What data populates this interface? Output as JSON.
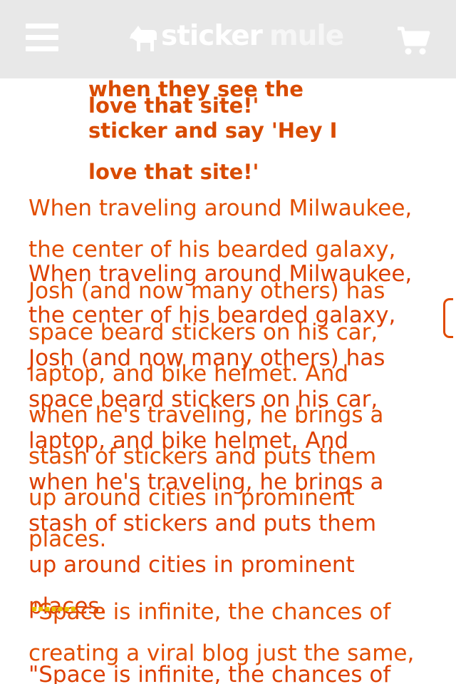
{
  "header": {
    "brand_part1": "sticker",
    "brand_part2": "mule",
    "menu_icon": "hamburger-menu-icon",
    "cart_icon": "shopping-cart-icon",
    "logo_icon": "mule-logo-icon"
  },
  "colors": {
    "header_bg": "#e8e8e8",
    "text_accent": "#e24a00"
  },
  "bold_lines_top": {
    "l1": "when they see the",
    "l2": "love that site!'"
  },
  "bold_lines": {
    "l1": "sticker and say 'Hey I",
    "l2": "love that site!'"
  },
  "para_a": {
    "l1": "When traveling around Milwaukee,",
    "l2": "the center of his bearded galaxy,",
    "l3": "Josh (and now many others) has",
    "l4": "space beard stickers on his car,",
    "l5": "laptop, and bike helmet. And",
    "l6": "when he's traveling, he brings a",
    "l7": "stash of stickers and puts them",
    "l8": "up around cities in prominent",
    "l9": "places."
  },
  "para_b": {
    "l1": "When traveling around Milwaukee,",
    "l2": "the center of his bearded galaxy,",
    "l3": "Josh (and now many others) has",
    "l4": "space beard stickers on his car,",
    "l5": "laptop, and bike helmet. And",
    "l6": "when he's traveling, he brings a",
    "l7": "stash of stickers and puts them",
    "l8": "up around cities in prominent",
    "l9": "places."
  },
  "quote_a": {
    "l1": "\"Space is infinite, the chances of",
    "l2": "creating a viral blog just the same,"
  },
  "quote_b": {
    "l1": "\"Space is infinite, the chances of"
  }
}
